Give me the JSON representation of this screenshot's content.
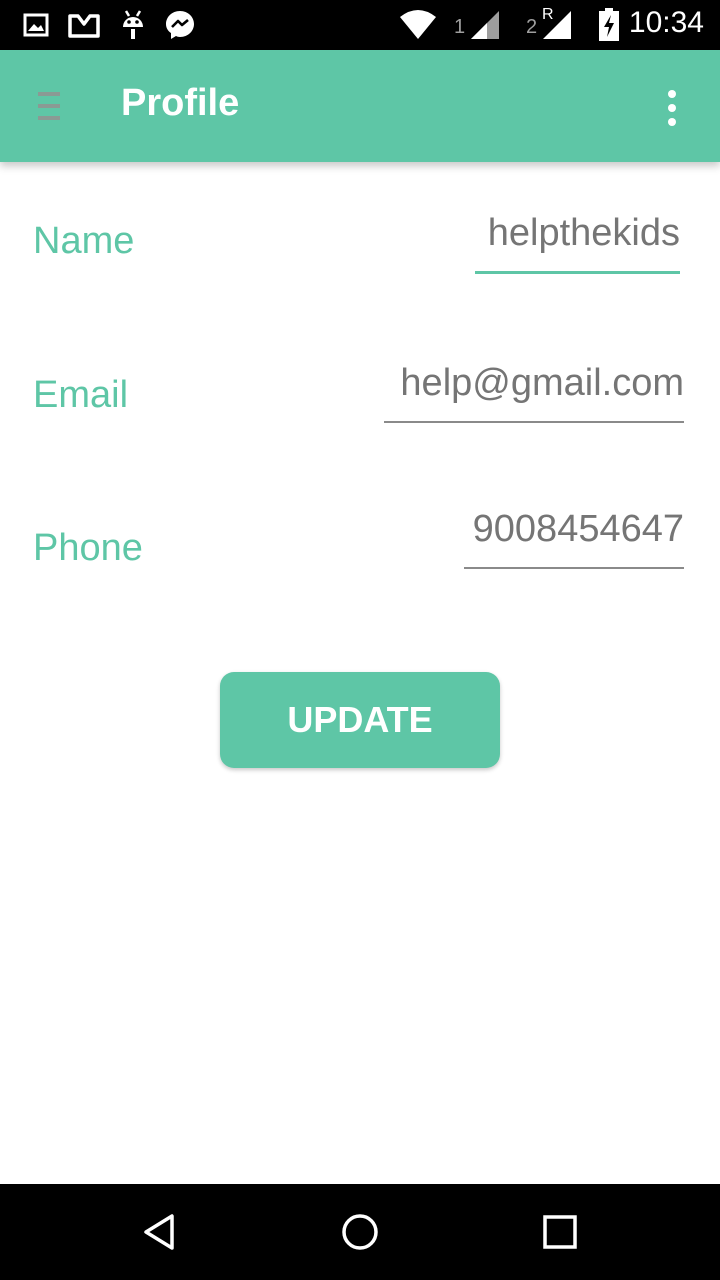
{
  "status_bar": {
    "time": "10:34",
    "sim1_label": "1",
    "sim2_label": "2",
    "roaming_label": "R",
    "icons": [
      "gallery-icon",
      "box-icon",
      "android-icon",
      "messenger-icon",
      "wifi-icon",
      "signal-icon",
      "signal-roaming-icon",
      "battery-charging-icon"
    ]
  },
  "app_bar": {
    "title": "Profile",
    "menu_icon": "hamburger-menu-icon",
    "overflow_icon": "more-vert-icon",
    "color": "#5ec6a6"
  },
  "form": {
    "name": {
      "label": "Name",
      "value": "helpthekids"
    },
    "email": {
      "label": "Email",
      "value": "help@gmail.com"
    },
    "phone": {
      "label": "Phone",
      "value": "9008454647"
    }
  },
  "update_button": {
    "label": "UPDATE"
  },
  "nav_bar": {
    "icons": [
      "back-icon",
      "home-icon",
      "recents-icon"
    ]
  },
  "colors": {
    "accent": "#5ec6a6",
    "text_secondary": "#757575"
  }
}
